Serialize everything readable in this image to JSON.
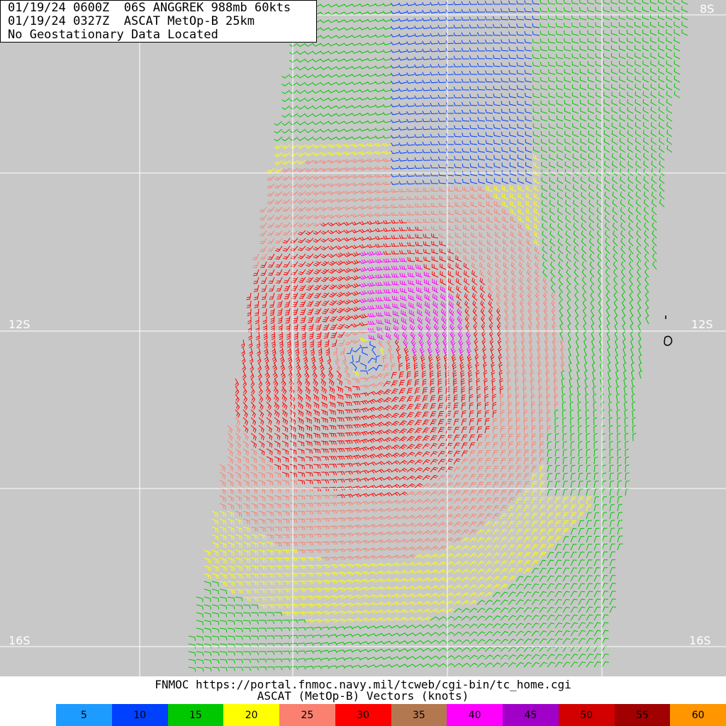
{
  "header": {
    "line1": "01/19/24 0600Z  06S ANGGREK 988mb 60kts",
    "line2": "01/19/24 0327Z  ASCAT MetOp-B 25km",
    "line3": "No Geostationary Data Located"
  },
  "latitude_labels": {
    "top_right": "8S",
    "mid_left": "12S",
    "mid_right": "12S",
    "bottom_left": "16S",
    "bottom_right": "16S"
  },
  "footer": {
    "source": "FNMOC https://portal.fnmoc.navy.mil/tcweb/cgi-bin/tc_home.cgi",
    "product": "ASCAT (MetOp-B) Vectors (knots)"
  },
  "legend": [
    {
      "label": "5",
      "color": "#1e9bff"
    },
    {
      "label": "10",
      "color": "#0040ff"
    },
    {
      "label": "15",
      "color": "#00c800"
    },
    {
      "label": "20",
      "color": "#ffff00"
    },
    {
      "label": "25",
      "color": "#fa8070"
    },
    {
      "label": "30",
      "color": "#ff0000"
    },
    {
      "label": "35",
      "color": "#b47850"
    },
    {
      "label": "40",
      "color": "#ff00ff"
    },
    {
      "label": "45",
      "color": "#a000c8"
    },
    {
      "label": "50",
      "color": "#d20000"
    },
    {
      "label": "55",
      "color": "#a00000"
    },
    {
      "label": "60",
      "color": "#ff9600"
    }
  ],
  "storm": {
    "name": "ANGGREK",
    "id": "06S",
    "pressure_mb": 988,
    "intensity_kts": 60
  }
}
